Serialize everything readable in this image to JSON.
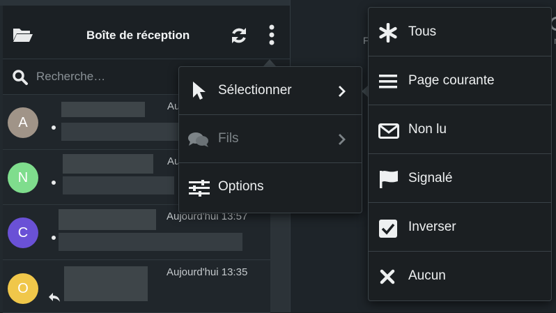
{
  "header": {
    "title": "Boîte de réception"
  },
  "search": {
    "placeholder": "Recherche…"
  },
  "messages": [
    {
      "initial": "A",
      "avatar_color": "#a09488",
      "time": "Auj",
      "unread": true
    },
    {
      "initial": "N",
      "avatar_color": "#7fdd8d",
      "time": "Au",
      "unread": true
    },
    {
      "initial": "C",
      "avatar_color": "#6a51d6",
      "time": "Aujourd'hui 13:57",
      "unread": true
    },
    {
      "initial": "O",
      "avatar_color": "#f0c74a",
      "time": "Aujourd'hui 13:35",
      "replied": true
    }
  ],
  "middle": {
    "letter": "F",
    "edge_letter": "n"
  },
  "context_menu": {
    "items": [
      {
        "label": "Sélectionner",
        "icon": "cursor-icon",
        "submenu": true,
        "disabled": false
      },
      {
        "label": "Fils",
        "icon": "comments-icon",
        "submenu": true,
        "disabled": true
      },
      {
        "label": "Options",
        "icon": "sliders-icon",
        "submenu": false,
        "disabled": false
      }
    ]
  },
  "select_menu": {
    "items": [
      {
        "label": "Tous",
        "icon": "asterisk-icon"
      },
      {
        "label": "Page courante",
        "icon": "list-icon"
      },
      {
        "label": "Non lu",
        "icon": "envelope-icon"
      },
      {
        "label": "Signalé",
        "icon": "flag-icon"
      },
      {
        "label": "Inverser",
        "icon": "checkbox-icon"
      },
      {
        "label": "Aucun",
        "icon": "x-icon"
      }
    ]
  },
  "colors": {
    "background": "#1a1e21",
    "panel": "#22292e",
    "menu": "#1b1f22",
    "text": "#eef0f1"
  }
}
